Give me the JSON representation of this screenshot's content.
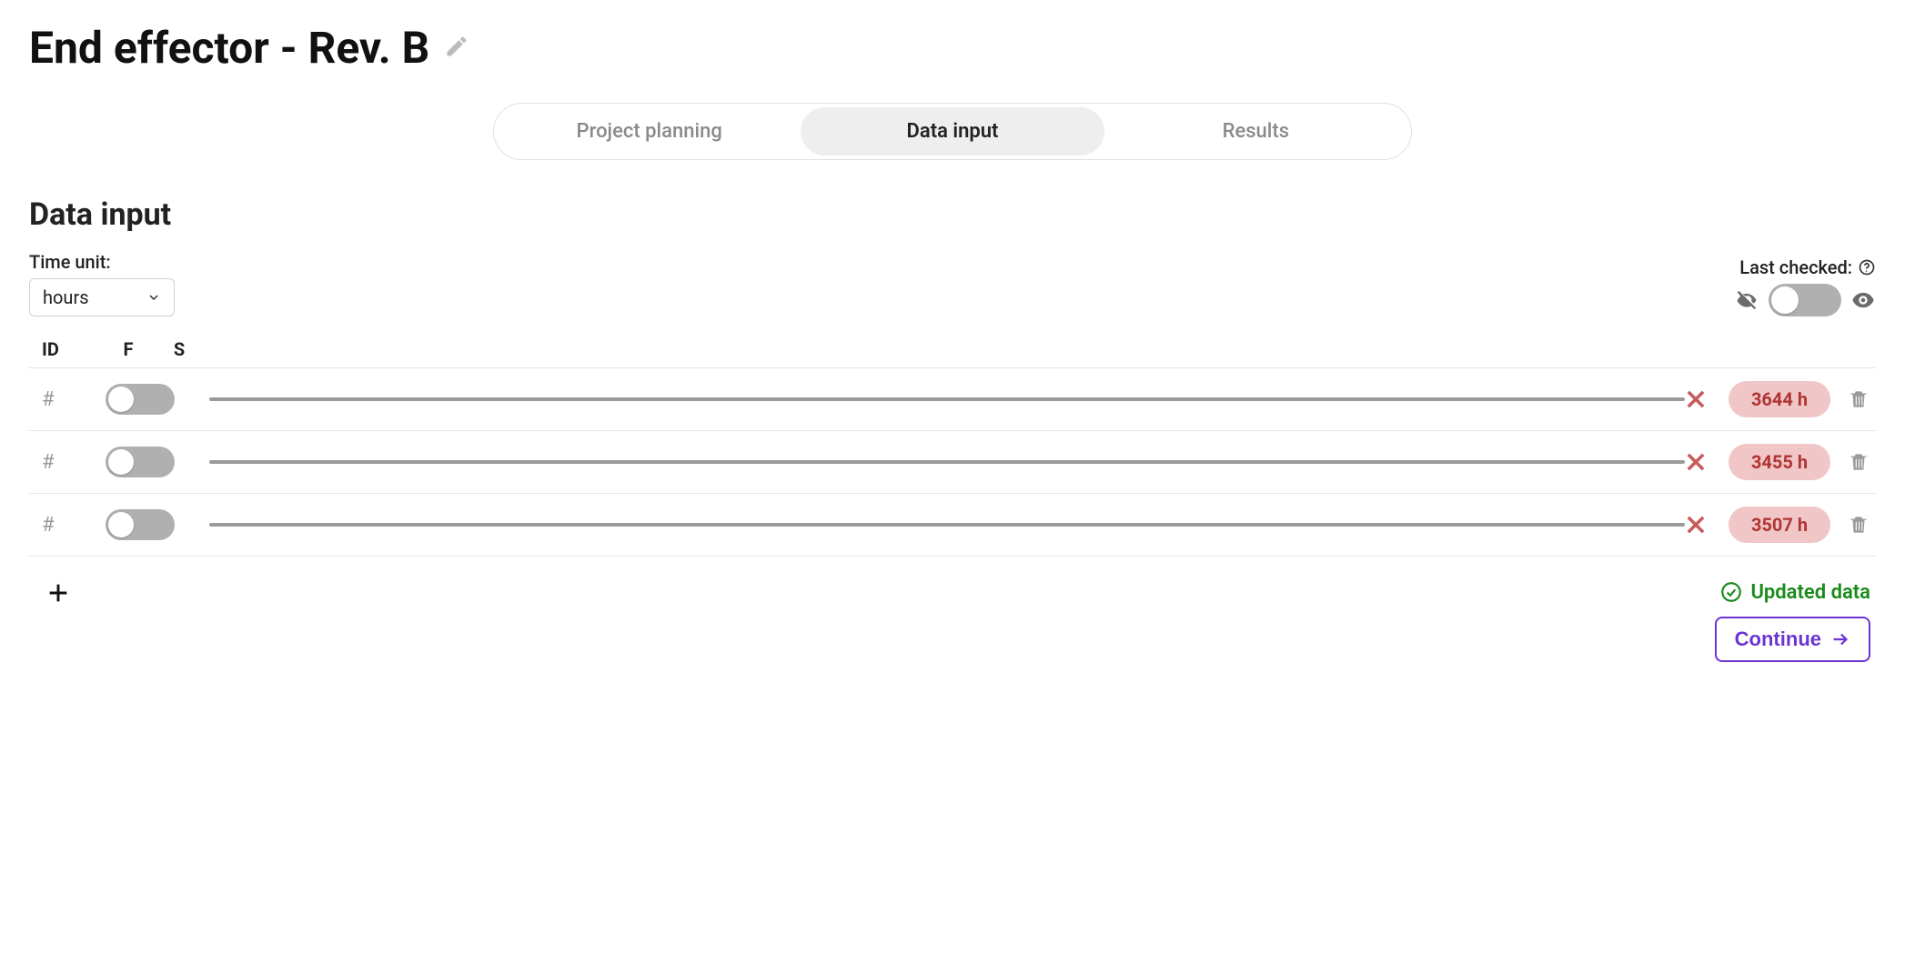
{
  "page": {
    "title": "End effector - Rev. B"
  },
  "tabs": {
    "items": [
      {
        "label": "Project planning",
        "active": false
      },
      {
        "label": "Data input",
        "active": true
      },
      {
        "label": "Results",
        "active": false
      }
    ]
  },
  "section": {
    "title": "Data input"
  },
  "time_unit": {
    "label": "Time unit:",
    "value": "hours"
  },
  "last_checked": {
    "label": "Last checked:",
    "toggle_on": false
  },
  "columns": {
    "id": "ID",
    "f": "F",
    "s": "S"
  },
  "rows": [
    {
      "id_placeholder": "#",
      "toggle_on": false,
      "badge": "3644 h"
    },
    {
      "id_placeholder": "#",
      "toggle_on": false,
      "badge": "3455 h"
    },
    {
      "id_placeholder": "#",
      "toggle_on": false,
      "badge": "3507 h"
    }
  ],
  "status": {
    "text": "Updated data"
  },
  "continue": {
    "label": "Continue"
  }
}
